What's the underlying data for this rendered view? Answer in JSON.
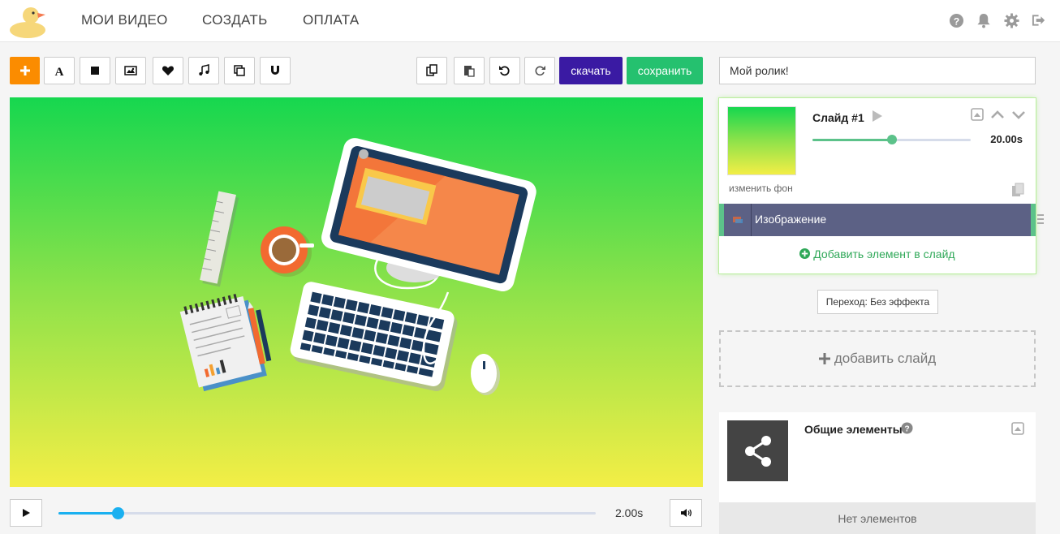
{
  "nav": {
    "my_videos": "МОИ ВИДЕО",
    "create": "СОЗДАТЬ",
    "payment": "ОПЛАТА"
  },
  "toolbar": {
    "add_icon": "plus-icon",
    "download_label": "скачать",
    "save_label": "сохранить",
    "download_color": "#3a1aa3",
    "save_color": "#25c16f",
    "add_color": "#fb8c00"
  },
  "player": {
    "time": "2.00s",
    "progress": 0.11
  },
  "project": {
    "title": "Мой ролик!"
  },
  "slide": {
    "title": "Слайд #1",
    "duration": "20.00s",
    "duration_fraction": 0.5,
    "change_bg": "изменить фон",
    "layer_label": "Изображение",
    "add_element": "Добавить элемент в слайд"
  },
  "transition": {
    "label": "Переход: Без эффекта"
  },
  "add_slide": {
    "label": "добавить слайд"
  },
  "common": {
    "title": "Общие элементы",
    "empty": "Нет элементов"
  },
  "colors": {
    "accent_green": "#5cc28a",
    "timeline_blue": "#1ab0f0",
    "layer_bg": "#5c6185"
  }
}
